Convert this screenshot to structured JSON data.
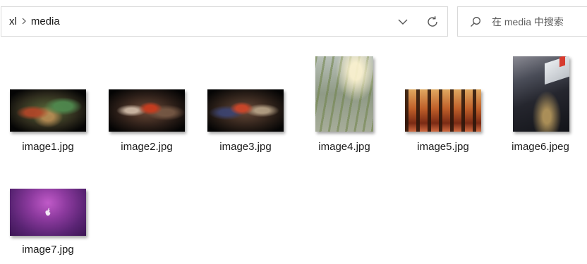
{
  "address_bar": {
    "breadcrumbs": [
      "xl",
      "media"
    ],
    "dropdown_icon": "chevron-down-icon",
    "refresh_icon": "refresh-icon"
  },
  "search": {
    "icon": "search-icon",
    "placeholder": "在 media 中搜索"
  },
  "files": [
    {
      "name": "image1.jpg"
    },
    {
      "name": "image2.jpg"
    },
    {
      "name": "image3.jpg"
    },
    {
      "name": "image4.jpg"
    },
    {
      "name": "image5.jpg"
    },
    {
      "name": "image6.jpeg"
    },
    {
      "name": "image7.jpg"
    }
  ]
}
